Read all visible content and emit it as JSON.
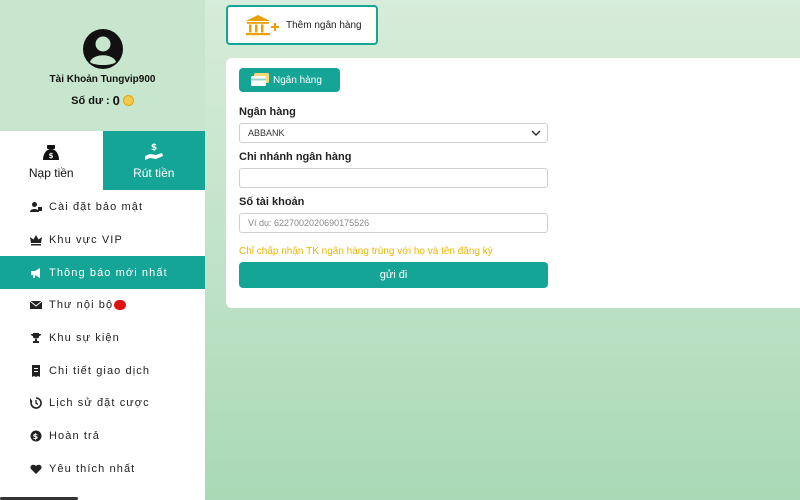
{
  "sidebar": {
    "account_label": "Tài Khoản Tungvip900",
    "balance_label": "Số dư :",
    "balance_value": "0",
    "tabs": [
      {
        "label": "Nạp tiền",
        "icon": "money-bag-icon"
      },
      {
        "label": "Rút tiền",
        "icon": "hand-money-icon"
      }
    ],
    "menu": [
      {
        "label": "Cài đặt bảo mật",
        "icon": "user-lock-icon"
      },
      {
        "label": "Khu vực VIP",
        "icon": "crown-icon"
      },
      {
        "label": "Thông báo mới nhất",
        "icon": "megaphone-icon",
        "active": true
      },
      {
        "label": "Thư nội bộ",
        "icon": "envelope-icon"
      },
      {
        "label": "Khu sự kiện",
        "icon": "trophy-icon"
      },
      {
        "label": "Chi tiết giao dịch",
        "icon": "receipt-icon"
      },
      {
        "label": "Lịch sử đặt cược",
        "icon": "history-icon"
      },
      {
        "label": "Hoàn trả",
        "icon": "dollar-circle-icon"
      },
      {
        "label": "Yêu thích nhất",
        "icon": "heart-icon"
      }
    ]
  },
  "main": {
    "add_bank_label": "Thêm ngân hàng",
    "bank_pill_label": "Ngân hàng",
    "fields": {
      "bank_label": "Ngân hàng",
      "bank_selected": "ABBANK",
      "branch_label": "Chi nhánh ngân hàng",
      "branch_value": "",
      "account_number_label": "Số tài khoản",
      "account_number_placeholder": "Ví dụ: 6227002020690175526"
    },
    "note": "Chỉ chấp nhận TK ngân hàng trùng với họ và tên đăng ký",
    "submit_label": "gửi đi"
  },
  "colors": {
    "accent": "#15a597",
    "warning_text": "#f0b400",
    "notification_dot": "#e01010"
  }
}
